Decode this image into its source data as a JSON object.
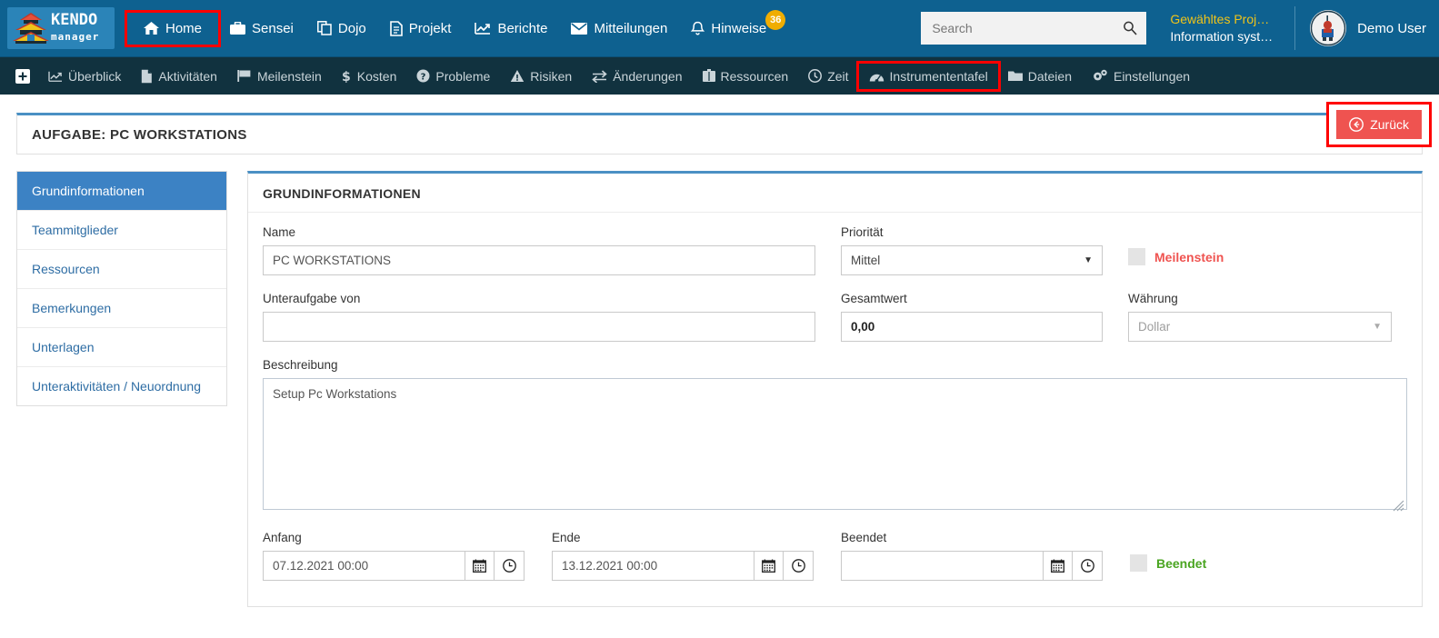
{
  "brand": {
    "name": "KENDO",
    "sub": "manager"
  },
  "topnav": {
    "items": [
      {
        "label": "Home",
        "icon": "home-icon",
        "highlight": true
      },
      {
        "label": "Sensei",
        "icon": "briefcase-icon",
        "highlight": false
      },
      {
        "label": "Dojo",
        "icon": "copy-icon",
        "highlight": false
      },
      {
        "label": "Projekt",
        "icon": "file-icon",
        "highlight": false
      },
      {
        "label": "Berichte",
        "icon": "chart-line-icon",
        "highlight": false
      },
      {
        "label": "Mitteilungen",
        "icon": "envelope-icon",
        "highlight": false
      },
      {
        "label": "Hinweise",
        "icon": "bell-icon",
        "highlight": false,
        "badge": "36"
      }
    ]
  },
  "search": {
    "placeholder": "Search",
    "value": "",
    "icon": "search-icon"
  },
  "project": {
    "selected_label": "Gewähltes Proj…",
    "name": "Information syst…"
  },
  "user": {
    "name": "Demo User",
    "avatar": "user-avatar"
  },
  "subnav": {
    "plus_icon": "plus-square-icon",
    "items": [
      {
        "label": "Überblick",
        "icon": "chart-line-icon",
        "highlight": false
      },
      {
        "label": "Aktivitäten",
        "icon": "file-lines-icon",
        "highlight": false
      },
      {
        "label": "Meilenstein",
        "icon": "flag-icon",
        "highlight": false
      },
      {
        "label": "Kosten",
        "icon": "dollar-icon",
        "highlight": false
      },
      {
        "label": "Probleme",
        "icon": "question-circle-icon",
        "highlight": false
      },
      {
        "label": "Risiken",
        "icon": "warning-triangle-icon",
        "highlight": false
      },
      {
        "label": "Änderungen",
        "icon": "exchange-icon",
        "highlight": false
      },
      {
        "label": "Ressourcen",
        "icon": "suitcase-icon",
        "highlight": false
      },
      {
        "label": "Zeit",
        "icon": "clock-icon",
        "highlight": false
      },
      {
        "label": "Instrumententafel",
        "icon": "dashboard-icon",
        "highlight": true
      },
      {
        "label": "Dateien",
        "icon": "folder-icon",
        "highlight": false
      },
      {
        "label": "Einstellungen",
        "icon": "gears-icon",
        "highlight": false
      }
    ]
  },
  "page": {
    "title": "AUFGABE: PC WORKSTATIONS",
    "back_label": "Zurück",
    "back_icon": "arrow-circle-left-icon"
  },
  "sidemenu": {
    "items": [
      {
        "label": "Grundinformationen",
        "active": true
      },
      {
        "label": "Teammitglieder",
        "active": false
      },
      {
        "label": "Ressourcen",
        "active": false
      },
      {
        "label": "Bemerkungen",
        "active": false
      },
      {
        "label": "Unterlagen",
        "active": false
      },
      {
        "label": "Unteraktivitäten / Neuordnung",
        "active": false
      }
    ]
  },
  "panel": {
    "heading": "GRUNDINFORMATIONEN",
    "fields": {
      "name": {
        "label": "Name",
        "value": "PC WORKSTATIONS"
      },
      "prioritaet": {
        "label": "Priorität",
        "value": "Mittel"
      },
      "meilenstein": {
        "label": "Meilenstein",
        "checked": false
      },
      "unteraufgabe_von": {
        "label": "Unteraufgabe von",
        "value": ""
      },
      "gesamtwert": {
        "label": "Gesamtwert",
        "value": "0,00"
      },
      "waehrung": {
        "label": "Währung",
        "value": "Dollar"
      },
      "beschreibung": {
        "label": "Beschreibung",
        "value": "Setup Pc Workstations"
      },
      "anfang": {
        "label": "Anfang",
        "value": "07.12.2021 00:00"
      },
      "ende": {
        "label": "Ende",
        "value": "13.12.2021 00:00"
      },
      "beendet_date": {
        "label": "Beendet",
        "value": ""
      },
      "beendet_check": {
        "label": "Beendet",
        "checked": false
      }
    },
    "icons": {
      "calendar": "calendar-icon",
      "clock": "clock-icon",
      "dropdown": "chevron-down-icon"
    }
  },
  "colors": {
    "topbar": "#0e6190",
    "subbar": "#11323f",
    "accent_blue": "#3c82c4",
    "panel_top_border": "#4a90c4",
    "link": "#2e6da4",
    "danger": "#ef5350",
    "success": "#4aa521",
    "badge": "#f0ad01",
    "highlight_outline": "#ff0000",
    "project_label": "#f0c419"
  }
}
